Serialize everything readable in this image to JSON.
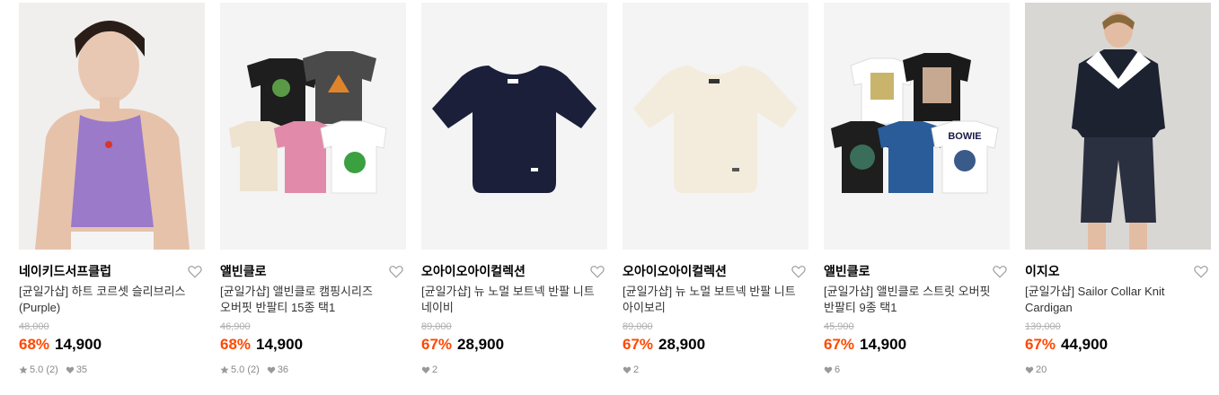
{
  "products": [
    {
      "brand": "네이키드서프클럽",
      "name": "[균일가샵] 하트 코르셋 슬리브리스 (Purple)",
      "original_price": "48,000",
      "discount": "68%",
      "price": "14,900",
      "rating": "5.0",
      "review_count": "(2)",
      "likes": "35",
      "image": "model-purple-sleeveless"
    },
    {
      "brand": "앨빈클로",
      "name": "[균일가샵] 앨빈클로 캠핑시리즈 오버핏 반팔티 15종 택1",
      "original_price": "46,900",
      "discount": "68%",
      "price": "14,900",
      "rating": "5.0",
      "review_count": "(2)",
      "likes": "36",
      "image": "camping-tshirts-set"
    },
    {
      "brand": "오아이오아이컬렉션",
      "name": "[균일가샵] 뉴 노멀 보트넥 반팔 니트 네이비",
      "original_price": "89,000",
      "discount": "67%",
      "price": "28,900",
      "likes": "2",
      "image": "navy-boatneck-knit"
    },
    {
      "brand": "오아이오아이컬렉션",
      "name": "[균일가샵] 뉴 노멀 보트넥 반팔 니트 아이보리",
      "original_price": "89,000",
      "discount": "67%",
      "price": "28,900",
      "likes": "2",
      "image": "ivory-boatneck-knit"
    },
    {
      "brand": "앨빈클로",
      "name": "[균일가샵] 앨빈클로 스트릿 오버핏 반팔티 9종 택1",
      "original_price": "45,900",
      "discount": "67%",
      "price": "14,900",
      "likes": "6",
      "image": "street-tshirts-set"
    },
    {
      "brand": "이지오",
      "name": "[균일가샵] Sailor Collar Knit Cardigan",
      "original_price": "139,000",
      "discount": "67%",
      "price": "44,900",
      "likes": "20",
      "image": "model-sailor-cardigan"
    }
  ],
  "colors": {
    "discount": "#ff4800",
    "muted": "#888888",
    "strike": "#b0b0b0",
    "thumb_bg": "#f2f2f2"
  },
  "icons": {
    "heart": "heart-outline-icon",
    "star": "star-icon",
    "like": "heart-filled-icon"
  }
}
